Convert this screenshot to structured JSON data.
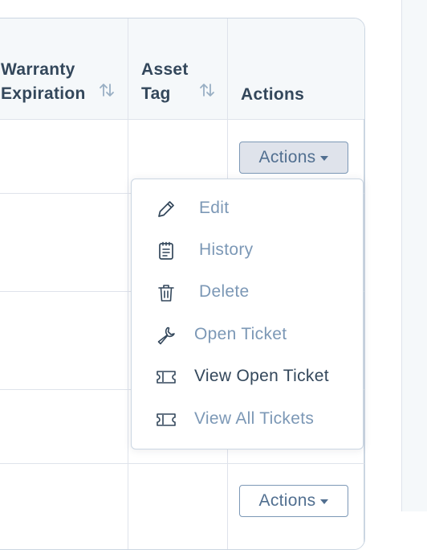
{
  "table": {
    "columns": [
      {
        "line1": "Warranty",
        "line2": "Expiration",
        "sortable": true
      },
      {
        "line1": "Asset",
        "line2": "Tag",
        "sortable": true
      },
      {
        "line1": "Actions",
        "line2": "",
        "sortable": false
      }
    ],
    "row_action_label": "Actions"
  },
  "actions_menu": {
    "items": [
      {
        "label": "Edit",
        "icon": "pencil-icon",
        "emphasis": false
      },
      {
        "label": "History",
        "icon": "clipboard-icon",
        "emphasis": false
      },
      {
        "label": "Delete",
        "icon": "trash-icon",
        "emphasis": false
      },
      {
        "label": "Open Ticket",
        "icon": "wrench-icon",
        "emphasis": false
      },
      {
        "label": "View Open Ticket",
        "icon": "ticket-icon",
        "emphasis": true
      },
      {
        "label": "View All Tickets",
        "icon": "ticket-icon",
        "emphasis": false
      }
    ]
  },
  "colors": {
    "text_dark": "#33475b",
    "text_muted": "#7c98b6",
    "border": "#cbd6e2",
    "header_bg": "#f5f8fa"
  }
}
